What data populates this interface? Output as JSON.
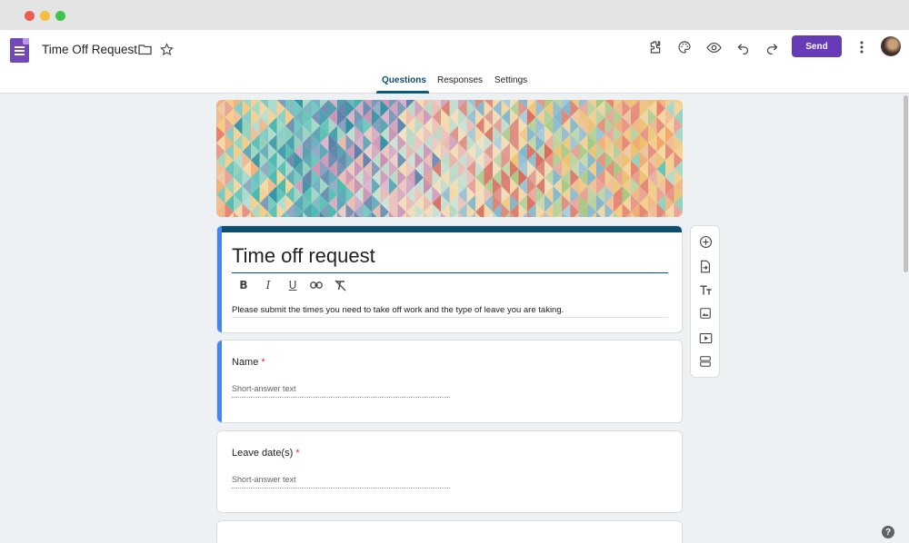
{
  "window": {
    "controls": [
      "close",
      "minimize",
      "zoom"
    ]
  },
  "appbar": {
    "app_icon": "forms-icon",
    "doc_title": "Time Off Request",
    "icons": [
      "folder-icon",
      "star-icon",
      "addon-icon",
      "palette-icon",
      "preview-eye-icon",
      "undo-icon",
      "redo-icon",
      "more-vert-icon"
    ],
    "send_label": "Send"
  },
  "tabs": [
    {
      "label": "Questions",
      "active": true
    },
    {
      "label": "Responses",
      "active": false
    },
    {
      "label": "Settings",
      "active": false
    }
  ],
  "form": {
    "title": "Time off request",
    "description": "Please submit the times you need to take off work and the type of leave you are taking.",
    "format_tools": [
      "bold-icon",
      "italic-icon",
      "underline-icon",
      "link-icon",
      "clear-format-icon"
    ]
  },
  "questions": [
    {
      "title": "Name",
      "required_mark": "*",
      "placeholder": "Short-answer text",
      "selected": true
    },
    {
      "title": "Leave date(s)",
      "required_mark": "*",
      "placeholder": "Short-answer text",
      "selected": false
    }
  ],
  "side_tools": [
    "add-question-icon",
    "import-questions-icon",
    "add-title-icon",
    "add-image-icon",
    "add-video-icon",
    "add-section-icon"
  ],
  "colors": {
    "accent": "#673ab7",
    "theme": "#0b4f6c",
    "selected_bar": "#4285f4",
    "required": "#d93025"
  }
}
